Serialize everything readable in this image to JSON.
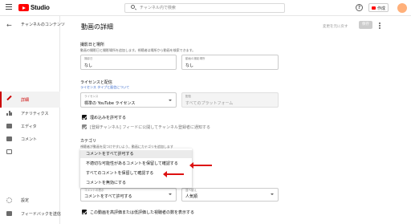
{
  "header": {
    "logo_text": "Studio",
    "search_placeholder": "チャンネル内で検索",
    "help_glyph": "?",
    "create_label": "作成"
  },
  "sidebar": {
    "back_glyph": "←",
    "channel_title": "チャンネルのコンテンツ",
    "items": [
      {
        "label": "詳細",
        "icon": "pencil-icon",
        "active": true
      },
      {
        "label": "アナリティクス",
        "icon": "analytics-icon"
      },
      {
        "label": "エディタ",
        "icon": "editor-icon"
      },
      {
        "label": "コメント",
        "icon": "comment-icon"
      },
      {
        "label": "",
        "icon": "subtitles-icon"
      }
    ],
    "settings_label": "設定",
    "feedback_label": "フィードバックを送信"
  },
  "main": {
    "title": "動画の詳細",
    "revert_label": "変更を元に戻す",
    "save_label": "保存",
    "recording": {
      "title": "撮影日と場所",
      "subtitle": "動画の撮影日と撮影場所を追加します。視聴者は場所から動画を検索できます。",
      "date_label": "撮影日",
      "date_value": "なし",
      "location_label": "動画の撮影場所",
      "location_value": "なし"
    },
    "license": {
      "title": "ライセンスと配信",
      "subtitle": "ライセンス タイプと配信について",
      "license_label": "ライセンス",
      "license_value": "標準の YouTube ライセンス",
      "distribution_label": "配信",
      "distribution_value": "すべてのプラットフォーム",
      "embed_label": "埋め込みを許可する",
      "notify_label": "[登録チャンネル] フィードに公開してチャンネル登録者に通知する"
    },
    "category": {
      "title": "カテゴリ",
      "subtitle": "視聴者が動画を見つけやすいよう、動画にカテゴリを追加します"
    },
    "comments_menu": {
      "items": [
        "コメントをすべて許可する",
        "不適切な可能性があるコメントを保留して確認する",
        "すべてのコメントを保留して確認する",
        "コメントを無効にする"
      ],
      "highlighted": 0
    },
    "comment_visibility_label": "コメントの表示",
    "comment_visibility_value": "コメントをすべて許可する",
    "sort_label": "並べ替え",
    "sort_value": "人気順",
    "rating_label": "この動画を高評価または低評価した視聴者の数を表示する"
  },
  "colors": {
    "brand_red": "#ff0000",
    "annotation_arrow": "#dd1111",
    "active_nav": "#cc0000"
  }
}
